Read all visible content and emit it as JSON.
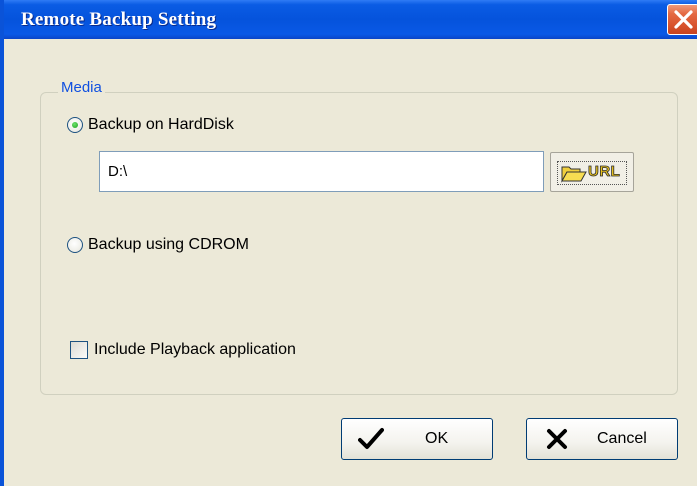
{
  "window": {
    "title": "Remote Backup Setting",
    "close_icon": "close-icon"
  },
  "media": {
    "group_label": "Media",
    "options": [
      {
        "label": "Backup on HardDisk",
        "selected": true
      },
      {
        "label": "Backup using CDROM",
        "selected": false
      }
    ],
    "path": {
      "value": "D:\\"
    },
    "browse_button": {
      "icon": "folder-url-icon",
      "text": "URL"
    },
    "include_playback": {
      "label": "Include Playback application",
      "checked": false
    }
  },
  "buttons": {
    "ok": {
      "label": "OK",
      "icon": "check-icon"
    },
    "cancel": {
      "label": "Cancel",
      "icon": "x-icon"
    }
  },
  "colors": {
    "title_bar": "#0553dc",
    "close_button": "#d8532d",
    "group_label": "#1050e0",
    "window_bg": "#ece9d8"
  }
}
